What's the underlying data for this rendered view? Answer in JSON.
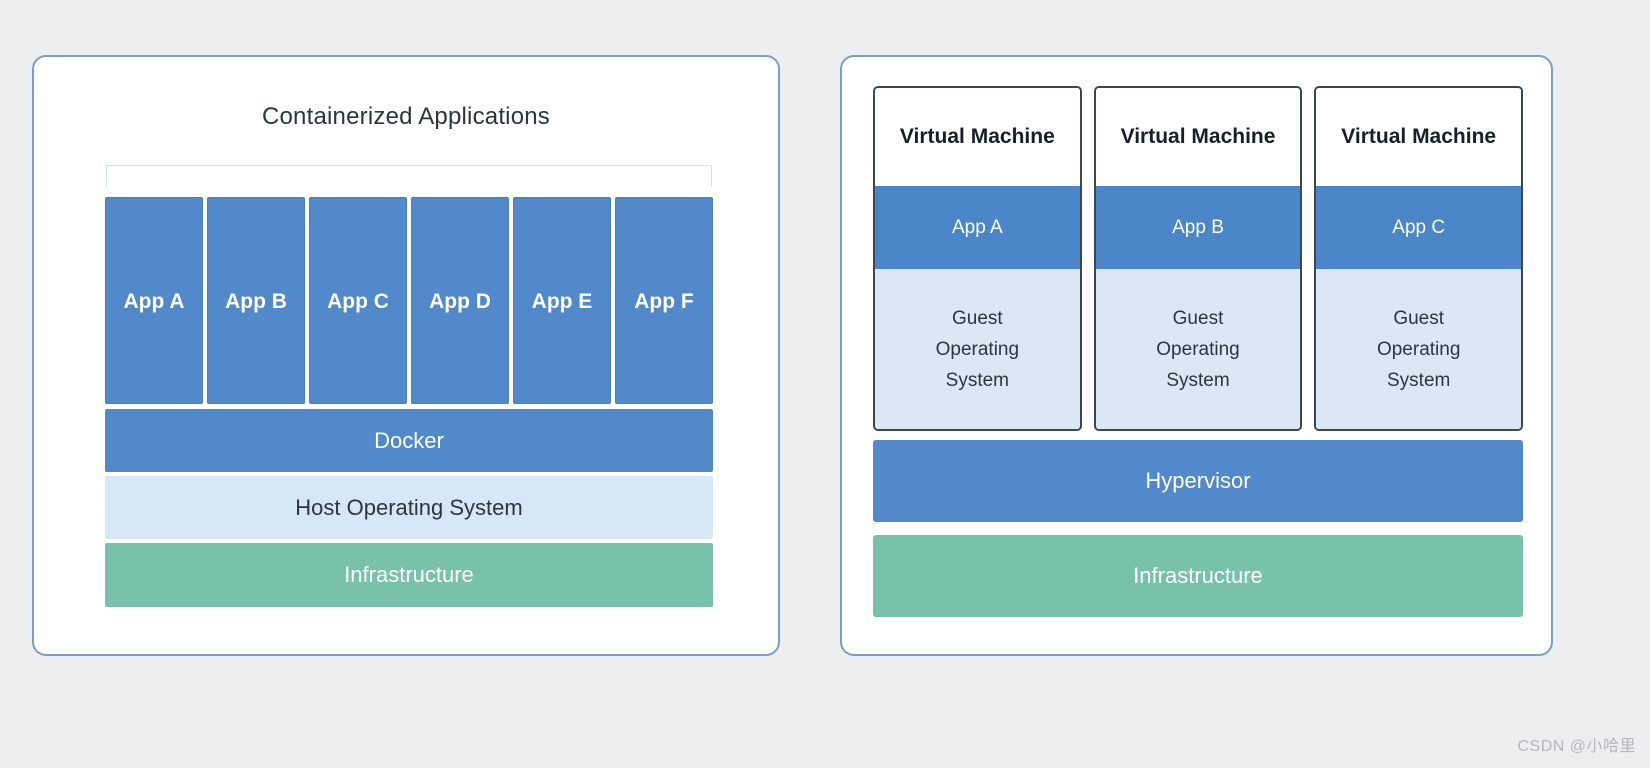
{
  "page": {
    "background_color": "#eceef0",
    "watermark": "CSDN @小哈里"
  },
  "colors": {
    "panel_border": "#7a9ec6",
    "app_blue": "#5189ca",
    "vm_app_blue": "#4a86c8",
    "light_blue": "#d6e7f5",
    "guest_os_blue": "#dae8f5",
    "infra_green": "#78c2ab",
    "vm_border": "#3c4550",
    "bracket": "#cfe2f3",
    "text_dark": "#2d3540",
    "text_light": "#ffffff",
    "watermark_gray": "#b4b7bb"
  },
  "container_panel": {
    "title": "Containerized Applications",
    "apps": [
      {
        "label": "App A"
      },
      {
        "label": "App B"
      },
      {
        "label": "App C"
      },
      {
        "label": "App D"
      },
      {
        "label": "App E"
      },
      {
        "label": "App F"
      }
    ],
    "layers": [
      {
        "key": "docker",
        "label": "Docker"
      },
      {
        "key": "host_os",
        "label": "Host Operating System"
      },
      {
        "key": "infrastructure",
        "label": "Infrastructure"
      }
    ],
    "docker_label": "Docker",
    "host_os_label": "Host Operating System",
    "infrastructure_label": "Infrastructure"
  },
  "vm_panel": {
    "machines": [
      {
        "title": "Virtual Machine",
        "app": "App A",
        "guest_os": "Guest Operating System"
      },
      {
        "title": "Virtual Machine",
        "app": "App B",
        "guest_os": "Guest Operating System"
      },
      {
        "title": "Virtual Machine",
        "app": "App C",
        "guest_os": "Guest Operating System"
      }
    ],
    "layers": [
      {
        "key": "hypervisor",
        "label": "Hypervisor"
      },
      {
        "key": "infrastructure",
        "label": "Infrastructure"
      }
    ],
    "hypervisor_label": "Hypervisor",
    "infrastructure_label": "Infrastructure"
  }
}
